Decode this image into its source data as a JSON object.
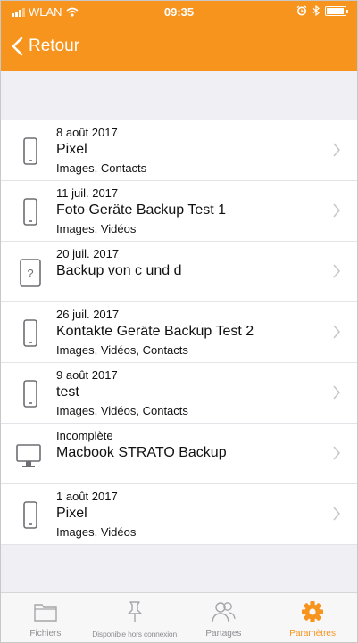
{
  "status_bar": {
    "carrier": "WLAN",
    "time": "09:35"
  },
  "nav": {
    "back_label": "Retour"
  },
  "backups": [
    {
      "date": "8 août 2017",
      "name": "Pixel",
      "content": "Images, Contacts",
      "device": "phone"
    },
    {
      "date": "11 juil. 2017",
      "name": "Foto Geräte Backup Test 1",
      "content": "Images, Vidéos",
      "device": "phone"
    },
    {
      "date": "20 juil. 2017",
      "name": "Backup von c und d",
      "content": "",
      "device": "unknown"
    },
    {
      "date": "26 juil. 2017",
      "name": "Kontakte Geräte Backup Test 2",
      "content": "Images, Vidéos, Contacts",
      "device": "phone"
    },
    {
      "date": "9 août 2017",
      "name": "test",
      "content": "Images, Vidéos, Contacts",
      "device": "phone"
    },
    {
      "date": "Incomplète",
      "name": "Macbook STRATO Backup",
      "content": "",
      "device": "desktop"
    },
    {
      "date": "1 août 2017",
      "name": "Pixel",
      "content": "Images, Vidéos",
      "device": "phone"
    }
  ],
  "tabs": [
    {
      "label": "Fichiers",
      "icon": "folder-icon",
      "active": false
    },
    {
      "label": "Disponible hors connexion",
      "icon": "pin-icon",
      "active": false
    },
    {
      "label": "Partages",
      "icon": "people-icon",
      "active": false
    },
    {
      "label": "Paramètres",
      "icon": "gear-icon",
      "active": true
    }
  ],
  "colors": {
    "accent": "#f7941d",
    "tab_inactive": "#8e8e93",
    "background": "#efeff4"
  }
}
